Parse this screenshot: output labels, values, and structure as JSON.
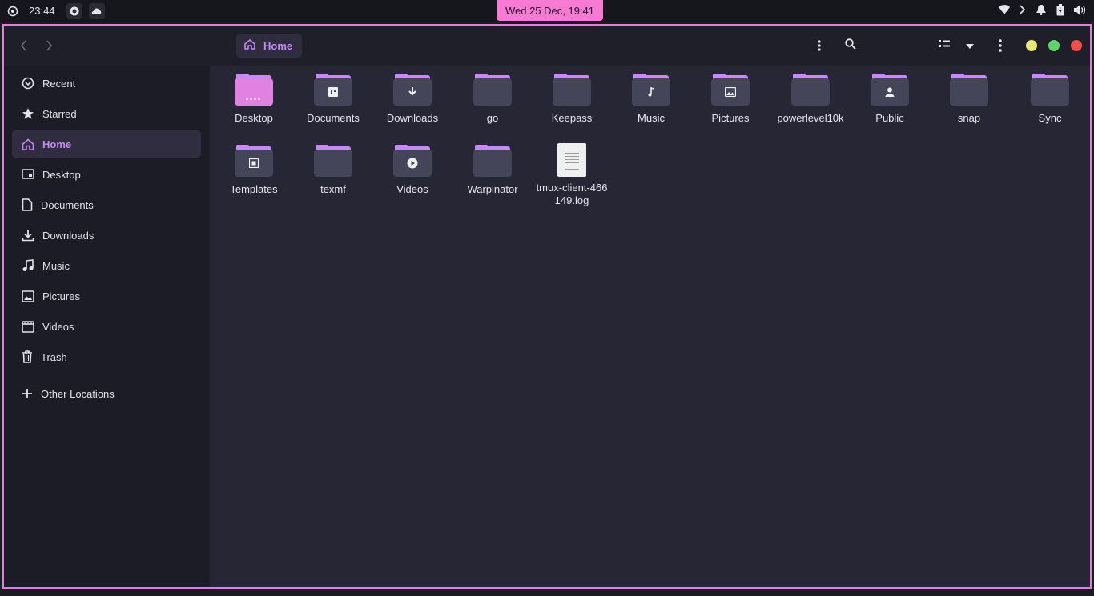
{
  "topbar": {
    "clock": "23:44",
    "date": "Wed 25 Dec, 19:41"
  },
  "headerbar": {
    "breadcrumb": "Home"
  },
  "sidebar": {
    "items": [
      {
        "label": "Recent",
        "icon": "clock-icon"
      },
      {
        "label": "Starred",
        "icon": "star-icon"
      },
      {
        "label": "Home",
        "icon": "home-icon",
        "active": true
      },
      {
        "label": "Desktop",
        "icon": "desktop-icon"
      },
      {
        "label": "Documents",
        "icon": "document-icon"
      },
      {
        "label": "Downloads",
        "icon": "download-icon"
      },
      {
        "label": "Music",
        "icon": "music-icon"
      },
      {
        "label": "Pictures",
        "icon": "picture-icon"
      },
      {
        "label": "Videos",
        "icon": "video-icon"
      },
      {
        "label": "Trash",
        "icon": "trash-icon"
      }
    ],
    "other_locations": "Other Locations"
  },
  "files": [
    {
      "label": "Desktop",
      "type": "folder",
      "emblem": "desktop"
    },
    {
      "label": "Documents",
      "type": "folder",
      "emblem": "document"
    },
    {
      "label": "Downloads",
      "type": "folder",
      "emblem": "download"
    },
    {
      "label": "go",
      "type": "folder",
      "emblem": ""
    },
    {
      "label": "Keepass",
      "type": "folder",
      "emblem": ""
    },
    {
      "label": "Music",
      "type": "folder",
      "emblem": "music"
    },
    {
      "label": "Pictures",
      "type": "folder",
      "emblem": "picture"
    },
    {
      "label": "powerlevel10k",
      "type": "folder",
      "emblem": ""
    },
    {
      "label": "Public",
      "type": "folder",
      "emblem": "public"
    },
    {
      "label": "snap",
      "type": "folder",
      "emblem": ""
    },
    {
      "label": "Sync",
      "type": "folder",
      "emblem": ""
    },
    {
      "label": "Templates",
      "type": "folder",
      "emblem": "template"
    },
    {
      "label": "texmf",
      "type": "folder",
      "emblem": ""
    },
    {
      "label": "Videos",
      "type": "folder",
      "emblem": "video"
    },
    {
      "label": "Warpinator",
      "type": "folder",
      "emblem": ""
    },
    {
      "label": "tmux-client-466149.log",
      "type": "file",
      "emblem": ""
    }
  ],
  "colors": {
    "accent": "#c58af5",
    "date_badge": "#f77bd3",
    "window_border": "#e07fd6",
    "minimize": "#e8e87a",
    "maximize": "#5fd46a",
    "close": "#f0504d"
  }
}
